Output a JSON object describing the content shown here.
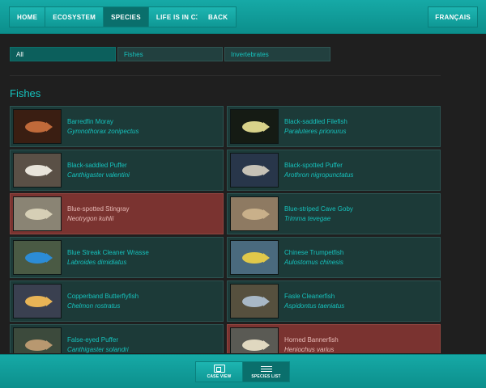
{
  "nav": {
    "items": [
      {
        "label": "HOME",
        "active": false
      },
      {
        "label": "ECOSYSTEM",
        "active": false
      },
      {
        "label": "SPECIES",
        "active": true
      },
      {
        "label": "LIFE IS IN CRISIS",
        "active": false
      }
    ],
    "back_label": "BACK",
    "language_label": "FRANÇAIS"
  },
  "filters": [
    {
      "label": "All",
      "active": true
    },
    {
      "label": "Fishes",
      "active": false
    },
    {
      "label": "Invertebrates",
      "active": false
    }
  ],
  "section_title": "Fishes",
  "species": [
    {
      "common": "Barredfin Moray",
      "latin": "Gymnothorax zonipectus",
      "highlight": false,
      "thumb": "#3a1e12",
      "fish": "#c06a3a"
    },
    {
      "common": "Black-saddled Filefish",
      "latin": "Paraluteres prionurus",
      "highlight": false,
      "thumb": "#151b14",
      "fish": "#d8d28a"
    },
    {
      "common": "Black-saddled Puffer",
      "latin": "Canthigaster valentini",
      "highlight": false,
      "thumb": "#5a5046",
      "fish": "#e8e4da"
    },
    {
      "common": "Black-spotted Puffer",
      "latin": "Arothron nigropunctatus",
      "highlight": false,
      "thumb": "#28364a",
      "fish": "#c6c2b6"
    },
    {
      "common": "Blue-spotted Stingray",
      "latin": "Neotrygon kuhlii",
      "highlight": true,
      "thumb": "#8a8474",
      "fish": "#d6cfb6"
    },
    {
      "common": "Blue-striped Cave Goby",
      "latin": "Trimma tevegae",
      "highlight": false,
      "thumb": "#8e7a62",
      "fish": "#c9b08a"
    },
    {
      "common": "Blue Streak Cleaner Wrasse",
      "latin": "Labroides dimidiatus",
      "highlight": false,
      "thumb": "#4a5a44",
      "fish": "#2c8cd6"
    },
    {
      "common": "Chinese Trumpetfish",
      "latin": "Aulostomus chinesis",
      "highlight": false,
      "thumb": "#4a6a7e",
      "fish": "#e0c84a"
    },
    {
      "common": "Copperband Butterflyfish",
      "latin": "Chelmon rostratus",
      "highlight": false,
      "thumb": "#3a4050",
      "fish": "#e8b456"
    },
    {
      "common": "Fasle Cleanerfish",
      "latin": "Aspidontus taeniatus",
      "highlight": false,
      "thumb": "#56503e",
      "fish": "#a8b8c6"
    },
    {
      "common": "False-eyed Puffer",
      "latin": "Canthigaster solandri",
      "highlight": false,
      "thumb": "#3c4a3c",
      "fish": "#b89870"
    },
    {
      "common": "Horned Bannerfish",
      "latin": "Heniochus varius",
      "highlight": true,
      "thumb": "#5a5a54",
      "fish": "#e0d8c0"
    }
  ],
  "view_switch": [
    {
      "label": "CASE VIEW",
      "icon": "case-view-icon",
      "active": false
    },
    {
      "label": "SPECIES LIST",
      "icon": "list-view-icon",
      "active": true
    }
  ],
  "colors": {
    "accent": "#16c2bd",
    "highlight_card": "#7a3330",
    "card": "#1c3a38",
    "bar": "#12a19e"
  }
}
